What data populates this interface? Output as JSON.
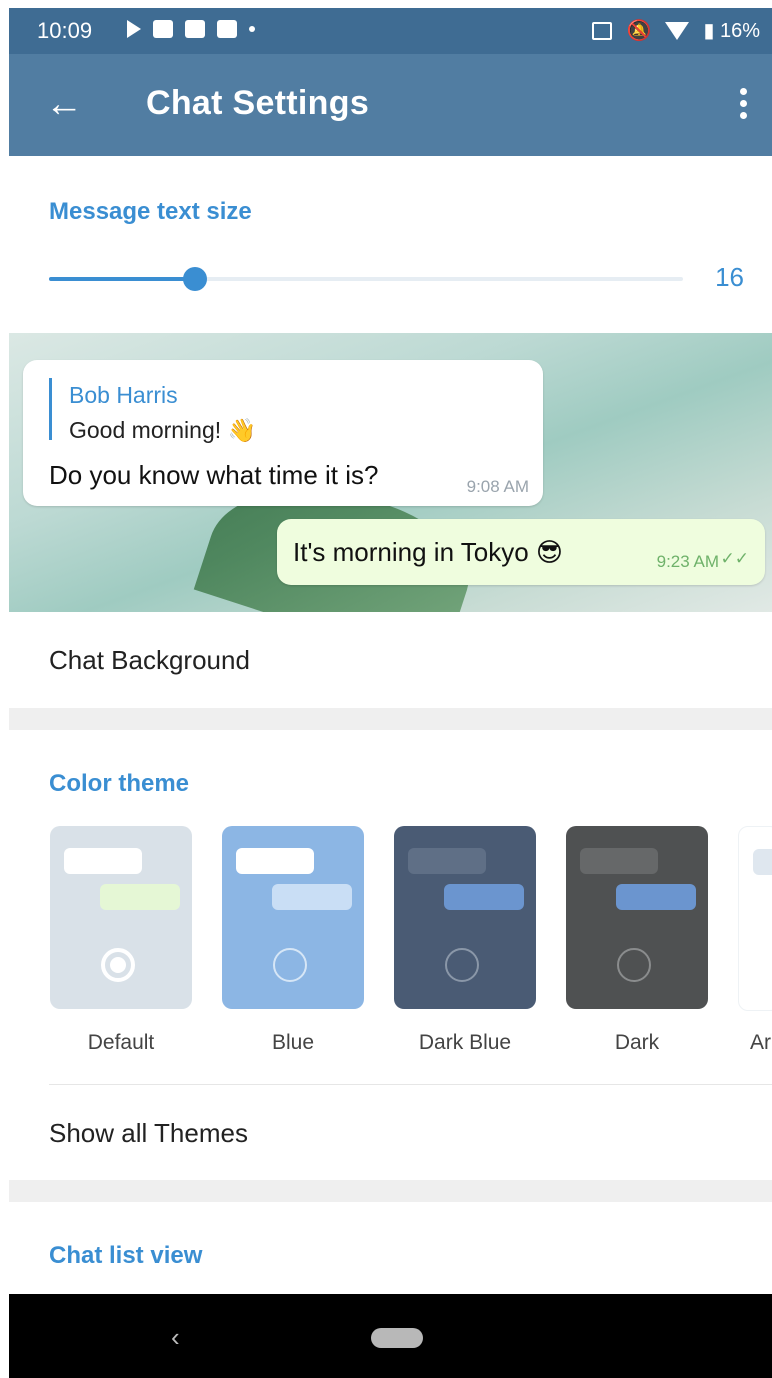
{
  "status": {
    "time": "10:09",
    "battery": "16%"
  },
  "appbar": {
    "title": "Chat Settings"
  },
  "text_size": {
    "header": "Message text size",
    "value": "16",
    "slider_fraction": 0.23
  },
  "preview": {
    "incoming": {
      "reply_name": "Bob Harris",
      "reply_text": "Good morning! 👋",
      "text": "Do you know what time it is?",
      "time": "9:08 AM"
    },
    "outgoing": {
      "text": "It's morning in Tokyo 😎",
      "time": "9:23 AM"
    }
  },
  "chat_background": {
    "label": "Chat Background"
  },
  "color_theme": {
    "header": "Color theme",
    "themes": [
      {
        "label": "Default"
      },
      {
        "label": "Blue"
      },
      {
        "label": "Dark Blue"
      },
      {
        "label": "Dark"
      },
      {
        "label": "Ar"
      }
    ],
    "show_all": "Show all Themes"
  },
  "chat_list_view": {
    "header": "Chat list view"
  },
  "colors": {
    "accent": "#3a8ed2",
    "appbar": "#517da2",
    "statusbar": "#3f6c93"
  }
}
